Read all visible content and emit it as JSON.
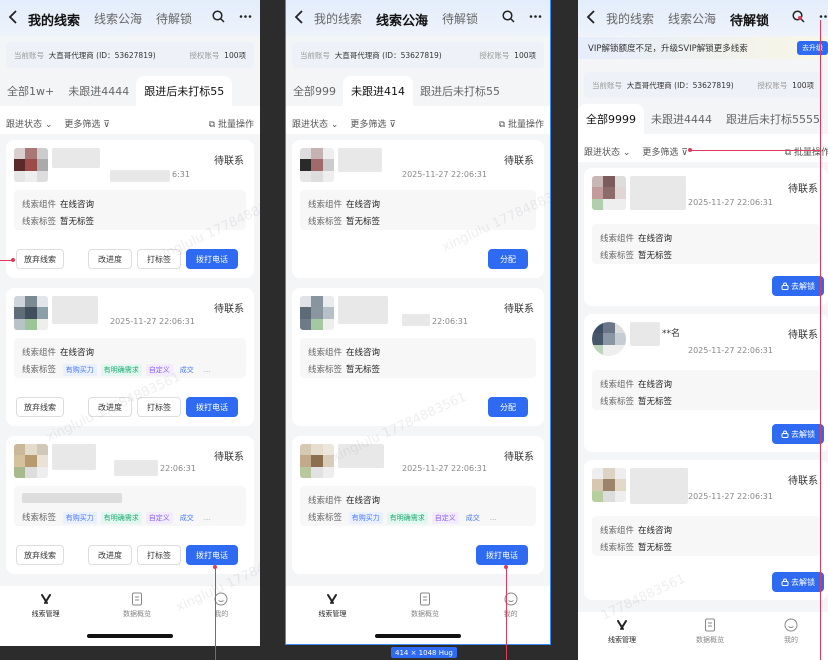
{
  "header": {
    "tabs": [
      "我的线索",
      "线索公海",
      "待解锁"
    ],
    "search_icon": "search-icon",
    "more_icon": "more-icon"
  },
  "account": {
    "current_label": "当前账号",
    "current_value": "大直哥代理商 (ID：53627819)",
    "auth_label": "授权账号",
    "auth_value": "100项"
  },
  "promo": {
    "text": "VIP解锁额度不足，升级SVIP解锁更多线索",
    "button": "去升级"
  },
  "filters": {
    "status": "跟进状态",
    "more": "更多筛选",
    "batch": "批量操作"
  },
  "phones": [
    {
      "active_top_tab": 0,
      "segments": [
        "全部1w+",
        "未跟进4444",
        "跟进后未打标55"
      ],
      "active_segment": 2
    },
    {
      "active_top_tab": 1,
      "segments": [
        "全部999",
        "未跟进414",
        "跟进后未打标55"
      ],
      "active_segment": 1
    },
    {
      "active_top_tab": 2,
      "segments": [
        "全部9999",
        "未跟进4444",
        "跟进后未打标5555"
      ],
      "active_segment": 0
    }
  ],
  "card": {
    "status": "待联系",
    "time": "2025-11-27 22:06:31",
    "time_short": "6:31",
    "time_p1c3": "22:06:31",
    "component_label": "线索组件",
    "component_value": "在线咨询",
    "tag_label": "线索标签",
    "tag_none": "暂无标签",
    "tags": [
      "有购买力",
      "有明确需求",
      "自定义",
      "成交"
    ],
    "ellipsis": "...",
    "masked_name": "**名"
  },
  "buttons": {
    "abandon": "放弃线索",
    "progress": "改进度",
    "tag": "打标签",
    "call": "拨打电话",
    "assign": "分配",
    "unlock": "去解锁"
  },
  "nav": [
    "线索管理",
    "数据概览",
    "我的"
  ],
  "watermark": [
    "xinglulu 17784883561",
    "xinglulu 17784883561",
    "17784883561"
  ],
  "size_badge": "414 × 1048 Hug",
  "colors": {
    "primary": "#2f6bf2",
    "annotation": "#e03a5a",
    "selection": "#3b8cf5"
  }
}
